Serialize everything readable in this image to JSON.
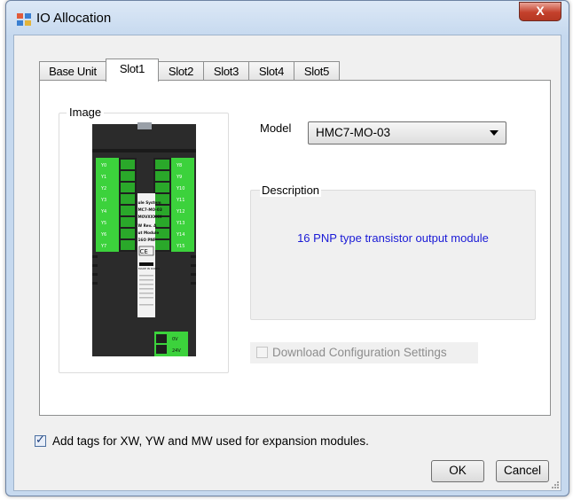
{
  "window": {
    "title": "IO Allocation",
    "close_label": "X"
  },
  "tabs": [
    {
      "label": "Base Unit"
    },
    {
      "label": "Slot1"
    },
    {
      "label": "Slot2"
    },
    {
      "label": "Slot3"
    },
    {
      "label": "Slot4"
    },
    {
      "label": "Slot5"
    }
  ],
  "active_tab": "Slot1",
  "image_group": {
    "label": "Image",
    "device": {
      "left_terminals": [
        "Y0",
        "Y1",
        "Y2",
        "Y3",
        "Y4",
        "Y5",
        "Y6",
        "Y7"
      ],
      "right_terminals": [
        "Y8",
        "Y9",
        "Y10",
        "Y11",
        "Y12",
        "Y13",
        "Y14",
        "Y15"
      ],
      "label_lines": [
        "ule System",
        "MC7-MO-03",
        "MOVXXXXX",
        "W Rev. A",
        "ut Module",
        "16O PNP",
        "MADE IN KOREA"
      ],
      "power_terminals": [
        "0V",
        "24V"
      ]
    }
  },
  "model": {
    "label": "Model",
    "value": "HMC7-MO-03"
  },
  "description": {
    "label": "Description",
    "text": "16 PNP type transistor output module"
  },
  "download_config": {
    "label": "Download Configuration Settings",
    "checked": false,
    "enabled": false
  },
  "add_tags": {
    "label": "Add tags for XW, YW and MW used for expansion  modules.",
    "checked": true
  },
  "buttons": {
    "ok": "OK",
    "cancel": "Cancel"
  },
  "colors": {
    "terminal_green": "#3cd23c",
    "description_text": "#1a1ad6",
    "title_bar": "#c6d9ef"
  }
}
